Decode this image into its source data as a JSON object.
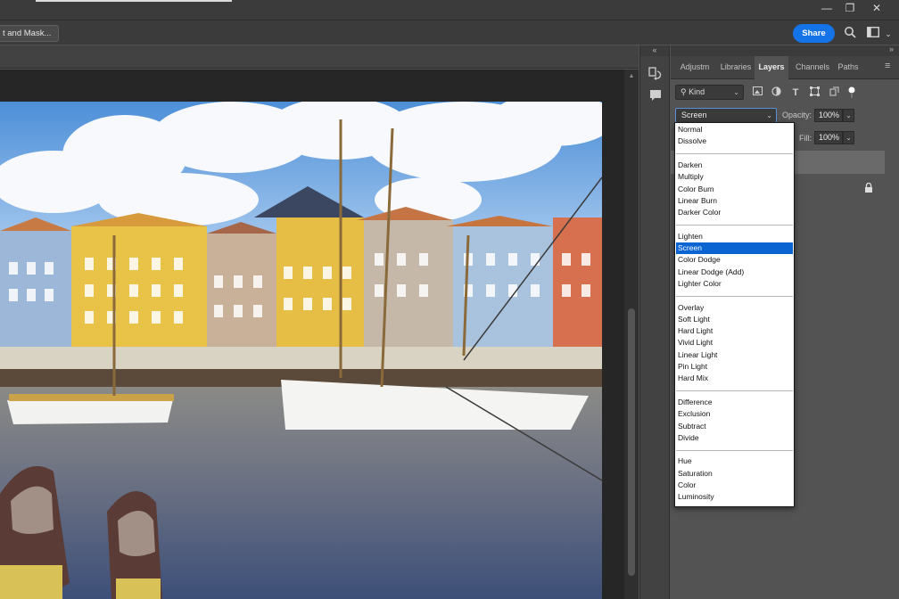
{
  "window": {
    "minimize_glyph": "—",
    "restore_glyph": "❐",
    "close_glyph": "✕"
  },
  "options_bar": {
    "select_mask_label": "t and Mask...",
    "share_label": "Share",
    "search_icon": "search-icon",
    "workspace_icon": "workspace-layout-icon"
  },
  "panel": {
    "collapse_glyph": "»",
    "collapse_left_glyph": "«",
    "tabs": [
      {
        "label": "Adjustm",
        "active": false
      },
      {
        "label": "Libraries",
        "active": false
      },
      {
        "label": "Layers",
        "active": true
      },
      {
        "label": "Channels",
        "active": false
      },
      {
        "label": "Paths",
        "active": false
      }
    ],
    "menu_glyph": "≡",
    "filter": {
      "kind_label": "Kind",
      "search_glyph": "⚲",
      "chevron": "⌄"
    },
    "blend": {
      "current": "Screen",
      "chevron": "⌄",
      "opacity_label": "Opacity:",
      "opacity_value": "100%",
      "fill_label": "Fill:",
      "fill_value": "100%"
    },
    "lock_glyph": "🔒"
  },
  "blend_modes": {
    "groups": [
      [
        "Normal",
        "Dissolve"
      ],
      [
        "Darken",
        "Multiply",
        "Color Burn",
        "Linear Burn",
        "Darker Color"
      ],
      [
        "Lighten",
        "Screen",
        "Color Dodge",
        "Linear Dodge (Add)",
        "Lighter Color"
      ],
      [
        "Overlay",
        "Soft Light",
        "Hard Light",
        "Vivid Light",
        "Linear Light",
        "Pin Light",
        "Hard Mix"
      ],
      [
        "Difference",
        "Exclusion",
        "Subtract",
        "Divide"
      ],
      [
        "Hue",
        "Saturation",
        "Color",
        "Luminosity"
      ]
    ],
    "selected": "Screen"
  },
  "colors": {
    "accent": "#1473e6",
    "selection": "#0a64d2",
    "panel_bg": "#535353",
    "chrome_bg": "#3b3b3b"
  }
}
